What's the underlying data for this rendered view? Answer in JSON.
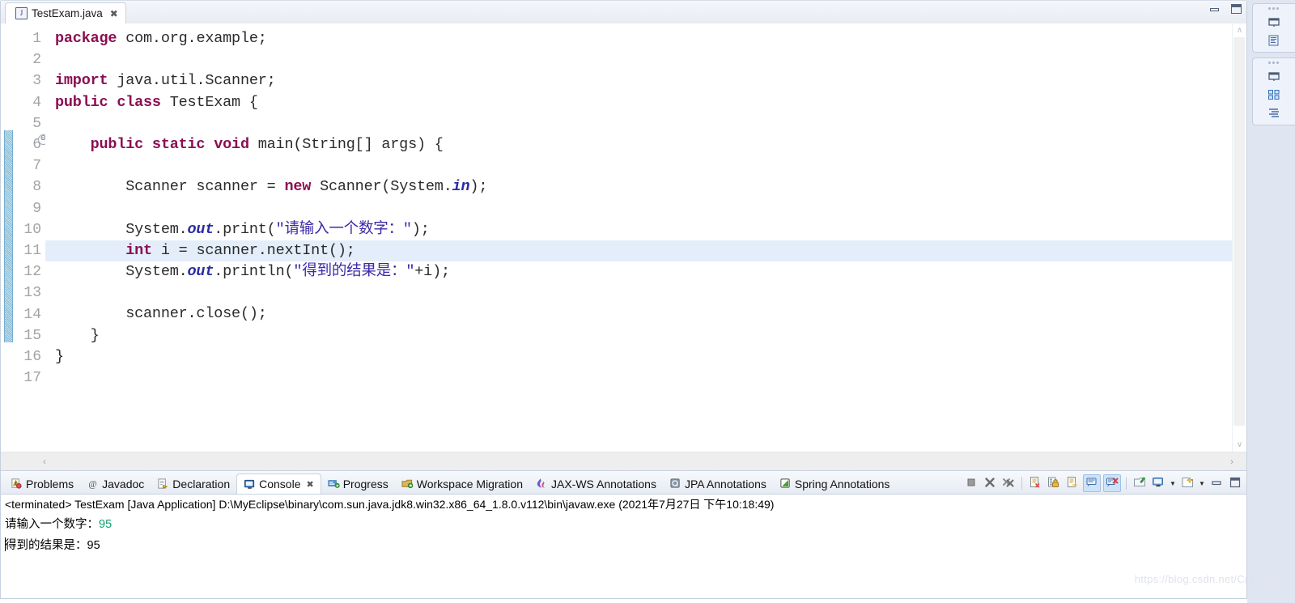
{
  "editor": {
    "tab": {
      "icon": "java-file-icon",
      "title": "TestExam.java",
      "close_glyph": "✖"
    },
    "window_buttons": {
      "minimize": "minimize-icon",
      "maximize": "maximize-icon"
    },
    "line_numbers": [
      "1",
      "2",
      "3",
      "4",
      "5",
      "6",
      "7",
      "8",
      "9",
      "10",
      "11",
      "12",
      "13",
      "14",
      "15",
      "16",
      "17"
    ],
    "fold_marker": "⊖",
    "current_line": 11,
    "code": [
      {
        "n": 1,
        "tokens": [
          {
            "t": "package",
            "c": "kw"
          },
          {
            "t": " com.org.example;",
            "c": "plain"
          }
        ]
      },
      {
        "n": 2,
        "tokens": [
          {
            "t": "",
            "c": "plain"
          }
        ]
      },
      {
        "n": 3,
        "tokens": [
          {
            "t": "import",
            "c": "kw"
          },
          {
            "t": " java.util.Scanner;",
            "c": "plain"
          }
        ]
      },
      {
        "n": 4,
        "tokens": [
          {
            "t": "public class",
            "c": "kw"
          },
          {
            "t": " TestExam {",
            "c": "plain"
          }
        ]
      },
      {
        "n": 5,
        "tokens": [
          {
            "t": "",
            "c": "plain"
          }
        ]
      },
      {
        "n": 6,
        "tokens": [
          {
            "t": "    ",
            "c": "plain"
          },
          {
            "t": "public static void",
            "c": "kw"
          },
          {
            "t": " main(String[] args) {",
            "c": "plain"
          }
        ]
      },
      {
        "n": 7,
        "tokens": [
          {
            "t": "",
            "c": "plain"
          }
        ]
      },
      {
        "n": 8,
        "tokens": [
          {
            "t": "        Scanner scanner = ",
            "c": "plain"
          },
          {
            "t": "new",
            "c": "kw"
          },
          {
            "t": " Scanner(System.",
            "c": "plain"
          },
          {
            "t": "in",
            "c": "kw-blue"
          },
          {
            "t": ");",
            "c": "plain"
          }
        ]
      },
      {
        "n": 9,
        "tokens": [
          {
            "t": "",
            "c": "plain"
          }
        ]
      },
      {
        "n": 10,
        "tokens": [
          {
            "t": "        System.",
            "c": "plain"
          },
          {
            "t": "out",
            "c": "kw-blue"
          },
          {
            "t": ".print(",
            "c": "plain"
          },
          {
            "t": "\"请输入一个数字：\"",
            "c": "str"
          },
          {
            "t": ");",
            "c": "plain"
          }
        ]
      },
      {
        "n": 11,
        "tokens": [
          {
            "t": "        ",
            "c": "plain"
          },
          {
            "t": "int",
            "c": "kw"
          },
          {
            "t": " i = scanner.nextInt();",
            "c": "plain"
          }
        ]
      },
      {
        "n": 12,
        "tokens": [
          {
            "t": "        System.",
            "c": "plain"
          },
          {
            "t": "out",
            "c": "kw-blue"
          },
          {
            "t": ".println(",
            "c": "plain"
          },
          {
            "t": "\"得到的结果是：\"",
            "c": "str"
          },
          {
            "t": "+i);",
            "c": "plain"
          }
        ]
      },
      {
        "n": 13,
        "tokens": [
          {
            "t": "",
            "c": "plain"
          }
        ]
      },
      {
        "n": 14,
        "tokens": [
          {
            "t": "        scanner.close();",
            "c": "plain"
          }
        ]
      },
      {
        "n": 15,
        "tokens": [
          {
            "t": "    }",
            "c": "plain"
          }
        ]
      },
      {
        "n": 16,
        "tokens": [
          {
            "t": "}",
            "c": "plain"
          }
        ]
      },
      {
        "n": 17,
        "tokens": [
          {
            "t": "",
            "c": "plain"
          }
        ]
      }
    ],
    "scroll_left_glyph": "‹",
    "scroll_right_glyph": "›",
    "scroll_up_glyph": "∧",
    "scroll_down_glyph": "∨"
  },
  "console_view": {
    "tabs": [
      {
        "label": "Problems",
        "icon": "problems-icon",
        "active": false
      },
      {
        "label": "Javadoc",
        "icon": "javadoc-at-icon",
        "active": false
      },
      {
        "label": "Declaration",
        "icon": "declaration-icon",
        "active": false
      },
      {
        "label": "Console",
        "icon": "console-icon",
        "active": true
      },
      {
        "label": "Progress",
        "icon": "progress-icon",
        "active": false
      },
      {
        "label": "Workspace Migration",
        "icon": "workspace-migration-icon",
        "active": false
      },
      {
        "label": "JAX-WS Annotations",
        "icon": "jaxws-annotations-icon",
        "active": false
      },
      {
        "label": "JPA Annotations",
        "icon": "jpa-annotations-icon",
        "active": false
      },
      {
        "label": "Spring Annotations",
        "icon": "spring-annotations-icon",
        "active": false
      }
    ],
    "active_tab_close": "✖",
    "toolbar": [
      {
        "name": "terminate-button",
        "icon": "terminate-square-icon",
        "pressed": false
      },
      {
        "name": "remove-launch-button",
        "icon": "remove-x-icon",
        "pressed": false
      },
      {
        "name": "remove-all-button",
        "icon": "remove-all-xx-icon",
        "pressed": false
      },
      {
        "name": "clear-console-button",
        "icon": "clear-console-icon",
        "pressed": false
      },
      {
        "name": "scroll-lock-button",
        "icon": "scroll-lock-icon",
        "pressed": false
      },
      {
        "name": "word-wrap-button",
        "icon": "word-wrap-icon",
        "pressed": false
      },
      {
        "name": "show-console-button",
        "icon": "show-console-icon",
        "pressed": true
      },
      {
        "name": "show-on-error-button",
        "icon": "show-on-error-icon",
        "pressed": true
      },
      {
        "name": "pin-console-button",
        "icon": "pin-console-icon",
        "pressed": false
      },
      {
        "name": "display-console-button",
        "icon": "display-console-icon",
        "pressed": false
      },
      {
        "name": "open-console-button",
        "icon": "open-console-icon",
        "pressed": false
      },
      {
        "name": "minimize-view-button",
        "icon": "minimize-icon",
        "pressed": false
      },
      {
        "name": "maximize-view-button",
        "icon": "maximize-icon",
        "pressed": false
      }
    ],
    "dropdown_caret": "▼",
    "output": {
      "terminated_line": "<terminated> TestExam [Java Application] D:\\MyEclipse\\binary\\com.sun.java.jdk8.win32.x86_64_1.8.0.v112\\bin\\javaw.exe (2021年7月27日 下午10:18:49)",
      "prompt_text": "请输入一个数字：",
      "input_value": "95",
      "result_text": "得到的结果是：95"
    }
  },
  "right_bar": {
    "groups": [
      {
        "icons": [
          "restore-view-icon",
          "outline-view-icon"
        ]
      },
      {
        "icons": [
          "restore-view-icon",
          "task-list-icon",
          "properties-view-icon"
        ]
      }
    ]
  },
  "watermark": "https://blog.csdn.net/Crezikod",
  "colors": {
    "keyword": "#8b0f52",
    "field_blue": "#2a2aa5",
    "string": "#3b2aa8",
    "current_line_bg": "#e4eefb",
    "console_input": "#0e9f6e",
    "tab_border": "#c9d2e0"
  }
}
